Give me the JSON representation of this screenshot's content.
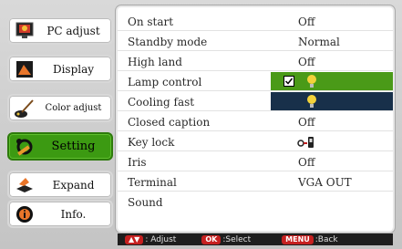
{
  "menu": {
    "items": [
      {
        "label": "PC adjust",
        "icon": "monitor-icon"
      },
      {
        "label": "Display",
        "icon": "display-icon"
      },
      {
        "label": "Color adjust",
        "icon": "brush-icon"
      },
      {
        "label": "Setting",
        "icon": "tools-icon"
      },
      {
        "label": "Expand",
        "icon": "expand-icon"
      },
      {
        "label": "Info.",
        "icon": "info-icon"
      }
    ],
    "selected": "Setting"
  },
  "settings": {
    "rows": [
      {
        "name": "On start",
        "value": "Off"
      },
      {
        "name": "Standby mode",
        "value": "Normal"
      },
      {
        "name": "High land",
        "value": "Off"
      },
      {
        "name": "Lamp control",
        "value": "",
        "icon": "lamp-icon",
        "checked": true
      },
      {
        "name": "Cooling fast",
        "value": "",
        "icon": "lamp-icon"
      },
      {
        "name": "Closed caption",
        "value": "Off"
      },
      {
        "name": "Key lock",
        "value": "",
        "icon": "key-lock-icon"
      },
      {
        "name": "Iris",
        "value": "Off"
      },
      {
        "name": "Terminal",
        "value": "VGA OUT"
      },
      {
        "name": "Sound",
        "value": ""
      }
    ]
  },
  "footer": {
    "adjust_key": "▲▼",
    "adjust_label": ": Adjust",
    "select_key": "OK",
    "select_label": ":Select",
    "back_key": "MENU",
    "back_label": ":Back"
  },
  "colors": {
    "selected_menu": "#3c9a12",
    "highlight_green": "#4a9a18",
    "highlight_dark": "#18304a",
    "key_red": "#c62020"
  }
}
